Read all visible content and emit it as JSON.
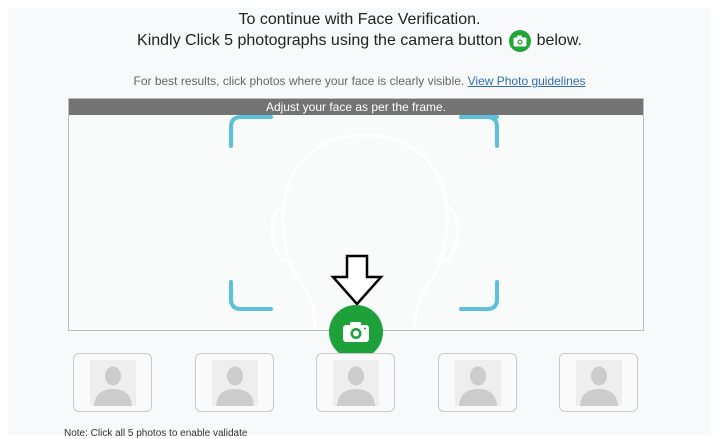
{
  "header": {
    "line1": "To continue with Face Verification.",
    "line2_before": "Kindly Click 5 photographs using the camera button",
    "line2_after": "below.",
    "inline_icon": "camera-icon"
  },
  "subline": {
    "text": "For best results, click photos where your face is clearly visible.",
    "link": "View Photo guidelines"
  },
  "camera_frame": {
    "banner": "Adjust your face as per the frame."
  },
  "capture_button": {
    "icon": "camera-icon"
  },
  "thumbnails": [
    {
      "icon": "user-placeholder-icon"
    },
    {
      "icon": "user-placeholder-icon"
    },
    {
      "icon": "user-placeholder-icon"
    },
    {
      "icon": "user-placeholder-icon"
    },
    {
      "icon": "user-placeholder-icon"
    }
  ],
  "note": "Note: Click all 5 photos to enable validate",
  "colors": {
    "accent_green": "#1ea03a",
    "corner_cyan": "#5bc0d8",
    "link": "#2f6db0",
    "banner": "#737373"
  }
}
